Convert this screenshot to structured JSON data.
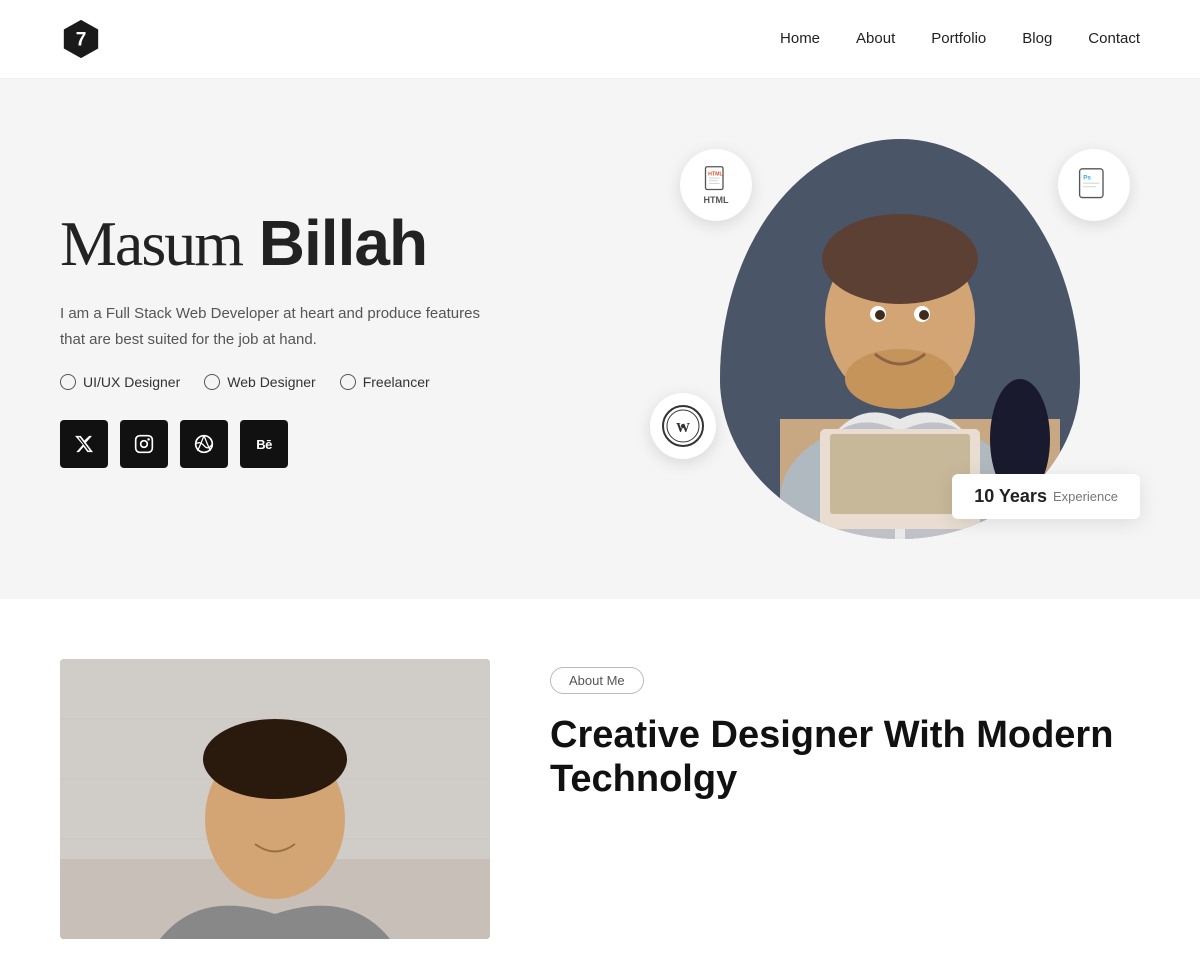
{
  "nav": {
    "links": [
      {
        "label": "Home",
        "id": "home"
      },
      {
        "label": "About",
        "id": "about"
      },
      {
        "label": "Portfolio",
        "id": "portfolio"
      },
      {
        "label": "Blog",
        "id": "blog"
      },
      {
        "label": "Contact",
        "id": "contact"
      }
    ]
  },
  "hero": {
    "first_name": "Masum",
    "last_name": "Billah",
    "description": "I am a Full Stack Web Developer at heart and produce features that are best suited for the job at hand.",
    "roles": [
      "UI/UX Designer",
      "Web Designer",
      "Freelancer"
    ],
    "social": [
      {
        "id": "twitter",
        "icon": "𝕏"
      },
      {
        "id": "instagram",
        "icon": "📷"
      },
      {
        "id": "dribbble",
        "icon": "🏀"
      },
      {
        "id": "behance",
        "icon": "Bē"
      }
    ],
    "experience": {
      "years": "10 Years",
      "label": "Experience"
    },
    "badges": {
      "html": "HTML",
      "ps": "Ps",
      "wp": "W"
    }
  },
  "about": {
    "tag": "About Me",
    "title_line1": "Creative Designer With Modern",
    "title_line2": "Technolgy"
  }
}
